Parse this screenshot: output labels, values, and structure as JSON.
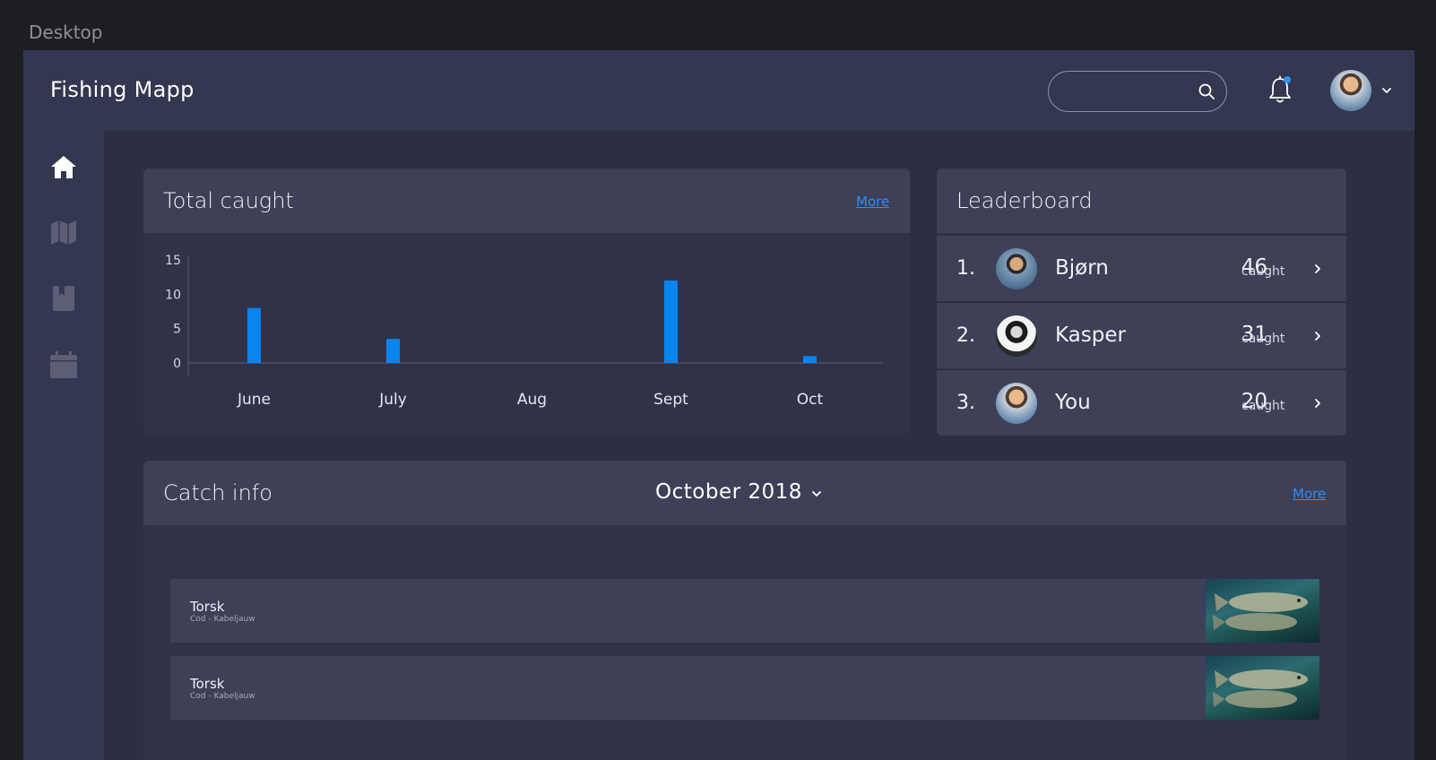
{
  "canvas": {
    "label": "Desktop"
  },
  "header": {
    "brand": "Fishing Mapp",
    "search": {
      "placeholder": "",
      "value": ""
    },
    "notification_dot_color": "#2a95ff"
  },
  "sidebar": {
    "items": [
      {
        "name": "home",
        "icon": "home-icon",
        "active": true
      },
      {
        "name": "map",
        "icon": "map-icon",
        "active": false
      },
      {
        "name": "logbook",
        "icon": "book-icon",
        "active": false
      },
      {
        "name": "calendar",
        "icon": "calendar-icon",
        "active": false
      }
    ]
  },
  "total_caught": {
    "title": "Total caught",
    "more_label": "More"
  },
  "chart_data": {
    "type": "bar",
    "title": "",
    "xlabel": "",
    "ylabel": "",
    "categories": [
      "June",
      "July",
      "Aug",
      "Sept",
      "Oct"
    ],
    "values": [
      8,
      3.5,
      0,
      12,
      1
    ],
    "ylim": [
      0,
      15
    ],
    "yticks": [
      0,
      5,
      10,
      15
    ],
    "color": "#0a84ee",
    "grid": false
  },
  "leaderboard": {
    "title": "Leaderboard",
    "unit": "caught",
    "rows": [
      {
        "rank": "1.",
        "name": "Bjørn",
        "count": "46"
      },
      {
        "rank": "2.",
        "name": "Kasper",
        "count": "31"
      },
      {
        "rank": "3.",
        "name": "You",
        "count": "20"
      }
    ]
  },
  "catch_info": {
    "title": "Catch info",
    "month": "October 2018",
    "more_label": "More",
    "rows": [
      {
        "name": "Torsk",
        "subtitle": "Cod - Kabeljauw"
      },
      {
        "name": "Torsk",
        "subtitle": "Cod - Kabeljauw"
      }
    ]
  }
}
